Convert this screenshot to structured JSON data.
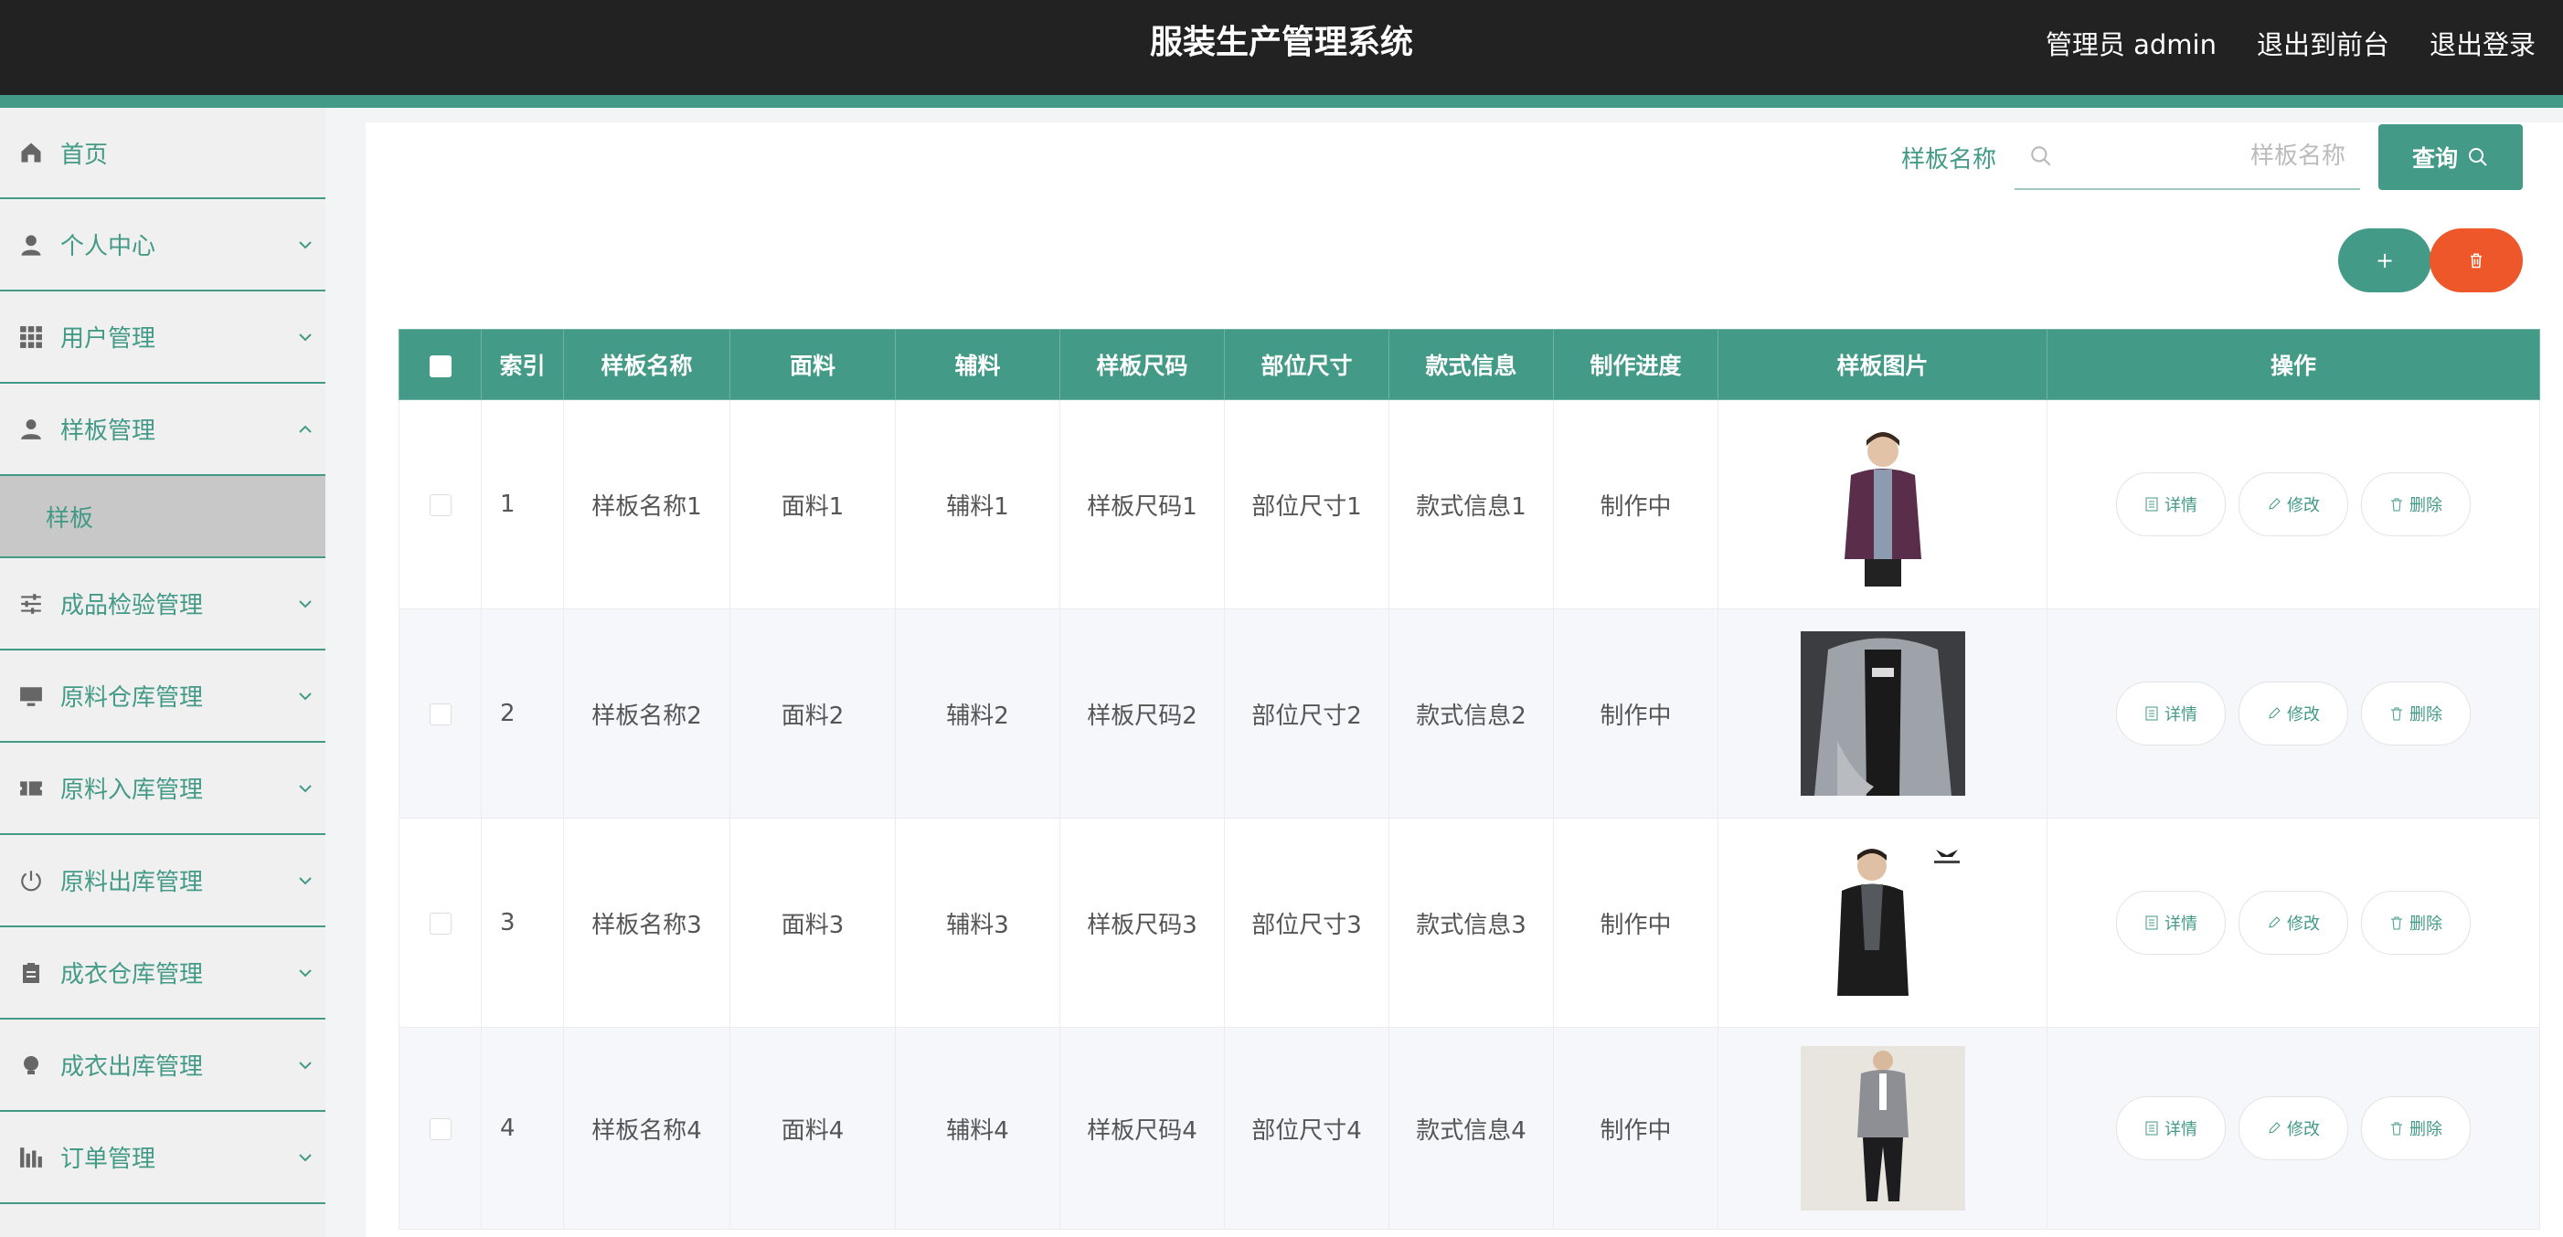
{
  "header": {
    "title": "服装生产管理系统",
    "admin_label": "管理员 admin",
    "exit_front": "退出到前台",
    "logout": "退出登录"
  },
  "sidebar": {
    "items": [
      {
        "label": "首页",
        "icon": "home-icon",
        "expandable": false
      },
      {
        "label": "个人中心",
        "icon": "person-icon",
        "expandable": true
      },
      {
        "label": "用户管理",
        "icon": "grid-icon",
        "expandable": true
      },
      {
        "label": "样板管理",
        "icon": "user-tie-icon",
        "expandable": true,
        "expanded": true,
        "children": [
          {
            "label": "样板"
          }
        ]
      },
      {
        "label": "成品检验管理",
        "icon": "sliders-icon",
        "expandable": true
      },
      {
        "label": "原料仓库管理",
        "icon": "monitor-icon",
        "expandable": true
      },
      {
        "label": "原料入库管理",
        "icon": "ticket-icon",
        "expandable": true
      },
      {
        "label": "原料出库管理",
        "icon": "power-icon",
        "expandable": true
      },
      {
        "label": "成衣仓库管理",
        "icon": "clipboard-icon",
        "expandable": true
      },
      {
        "label": "成衣出库管理",
        "icon": "bulb-icon",
        "expandable": true
      },
      {
        "label": "订单管理",
        "icon": "chart-icon",
        "expandable": true
      }
    ]
  },
  "search": {
    "label": "样板名称",
    "value": "",
    "placeholder": "样板名称",
    "query_label": "查询"
  },
  "actions": {
    "add_symbol": "+",
    "delete_icon": "trash-icon"
  },
  "table": {
    "columns": [
      "索引",
      "样板名称",
      "面料",
      "辅料",
      "样板尺码",
      "部位尺寸",
      "款式信息",
      "制作进度",
      "样板图片",
      "操作"
    ],
    "rows": [
      {
        "index": "1",
        "name": "样板名称1",
        "fabric": "面料1",
        "accessory": "辅料1",
        "size": "样板尺码1",
        "part_size": "部位尺寸1",
        "style": "款式信息1",
        "progress": "制作中"
      },
      {
        "index": "2",
        "name": "样板名称2",
        "fabric": "面料2",
        "accessory": "辅料2",
        "size": "样板尺码2",
        "part_size": "部位尺寸2",
        "style": "款式信息2",
        "progress": "制作中"
      },
      {
        "index": "3",
        "name": "样板名称3",
        "fabric": "面料3",
        "accessory": "辅料3",
        "size": "样板尺码3",
        "part_size": "部位尺寸3",
        "style": "款式信息3",
        "progress": "制作中"
      },
      {
        "index": "4",
        "name": "样板名称4",
        "fabric": "面料4",
        "accessory": "辅料4",
        "size": "样板尺码4",
        "part_size": "部位尺寸4",
        "style": "款式信息4",
        "progress": "制作中"
      }
    ],
    "ops": {
      "detail": "详情",
      "edit": "修改",
      "delete": "删除"
    }
  },
  "colors": {
    "primary": "#439a87",
    "danger": "#ed5729",
    "topbar": "#222222"
  }
}
